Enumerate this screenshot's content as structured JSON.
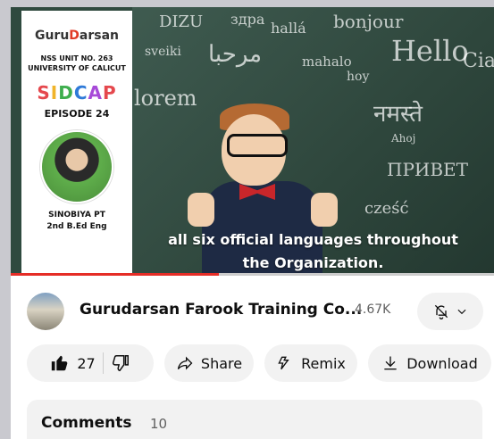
{
  "thumbnail": {
    "brand_prefix": "GuruD",
    "brand_suffix": "arsan",
    "nss_line1": "NSS UNIT NO. 263",
    "nss_line2": "UNIVERSITY OF CALICUT",
    "series_letters": [
      "S",
      "I",
      "D",
      "C",
      "A",
      "P"
    ],
    "series_colors": [
      "#e5484d",
      "#f0b429",
      "#3fae4e",
      "#2f7ad8",
      "#a74ad8",
      "#e5484d"
    ],
    "episode": "EPISODE 24",
    "person_name": "SINOBIYA PT",
    "person_role": "2nd B.Ed Eng",
    "chalk_words": [
      "DIZU",
      "здра",
      "hallá",
      "bonjour",
      "sveiki",
      "مرحبا",
      "mahalo",
      "Hello",
      "hoy",
      "lorem",
      "नमस्ते",
      "Ahoj",
      "ПРИВЕТ",
      "cześć",
      "Ciao"
    ],
    "caption_line1": "all six official languages throughout",
    "caption_line2": "the Organization.",
    "progress_fraction": 0.43
  },
  "channel": {
    "name": "Gurudarsan Farook Training Co...",
    "subscribers": "4.67K",
    "bell_icon": "bell-off-icon",
    "chevron_icon": "chevron-down-icon"
  },
  "actions": {
    "like_count": "27",
    "share_label": "Share",
    "remix_label": "Remix",
    "download_label": "Download"
  },
  "comments": {
    "title": "Comments",
    "count": "10"
  },
  "colors": {
    "accent_red": "#e52d27",
    "pill_bg": "#f2f2f2"
  }
}
